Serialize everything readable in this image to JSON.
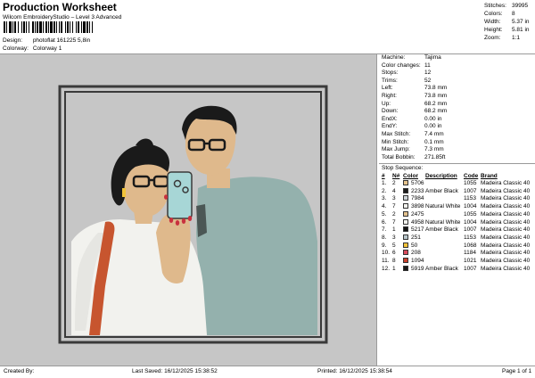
{
  "header": {
    "title": "Production Worksheet",
    "subtitle": "Wilcom EmbroideryStudio – Level 3 Advanced",
    "design_label": "Design:",
    "design_value": "photoflat 161225 5,8in",
    "colorway_label": "Colorway:",
    "colorway_value": "Colorway 1"
  },
  "stats": [
    {
      "label": "Stitches:",
      "value": "39995"
    },
    {
      "label": "Colors:",
      "value": "8"
    },
    {
      "label": "Width:",
      "value": "5.37 in"
    },
    {
      "label": "Height:",
      "value": "5.81 in"
    },
    {
      "label": "Zoom:",
      "value": "1:1"
    }
  ],
  "machine": [
    {
      "label": "Machine:",
      "value": "Tajima"
    },
    {
      "label": "Color changes:",
      "value": "11"
    },
    {
      "label": "Stops:",
      "value": "12"
    },
    {
      "label": "Trims:",
      "value": "52"
    },
    {
      "label": "Left:",
      "value": "73.8 mm"
    },
    {
      "label": "Right:",
      "value": "73.8 mm"
    },
    {
      "label": "Up:",
      "value": "68.2 mm"
    },
    {
      "label": "Down:",
      "value": "68.2 mm"
    },
    {
      "label": "EndX:",
      "value": "0.00 in"
    },
    {
      "label": "EndY:",
      "value": "0.00 in"
    },
    {
      "label": "Max Stitch:",
      "value": "7.4 mm"
    },
    {
      "label": "Min Stitch:",
      "value": "0.1 mm"
    },
    {
      "label": "Max Jump:",
      "value": "7.3 mm"
    },
    {
      "label": "Total Bobbin:",
      "value": "271.85ft"
    }
  ],
  "sequence": {
    "title": "Stop Sequence:",
    "headers": [
      "#",
      "N#",
      "Color",
      "Description",
      "Code",
      "Brand"
    ],
    "rows": [
      {
        "num": "1.",
        "n": "2",
        "color_code": "5706",
        "hex": "#e6c48e",
        "desc": "",
        "code": "1055",
        "brand": "Madeira Classic 40"
      },
      {
        "num": "2.",
        "n": "4",
        "color_code": "2233",
        "hex": "#1c1c1c",
        "desc": "Amber Black",
        "code": "1007",
        "brand": "Madeira Classic 40"
      },
      {
        "num": "3.",
        "n": "3",
        "color_code": "7984",
        "hex": "#cbd2d6",
        "desc": "",
        "code": "1153",
        "brand": "Madeira Classic 40"
      },
      {
        "num": "4.",
        "n": "7",
        "color_code": "3898",
        "hex": "#f3f3ee",
        "desc": "Natural White",
        "code": "1004",
        "brand": "Madeira Classic 40"
      },
      {
        "num": "5.",
        "n": "2",
        "color_code": "2475",
        "hex": "#e2c08c",
        "desc": "",
        "code": "1055",
        "brand": "Madeira Classic 40"
      },
      {
        "num": "6.",
        "n": "7",
        "color_code": "4958",
        "hex": "#f4f4ef",
        "desc": "Natural White",
        "code": "1004",
        "brand": "Madeira Classic 40"
      },
      {
        "num": "7.",
        "n": "1",
        "color_code": "5217",
        "hex": "#141414",
        "desc": "Amber Black",
        "code": "1007",
        "brand": "Madeira Classic 40"
      },
      {
        "num": "8.",
        "n": "3",
        "color_code": "251",
        "hex": "#b9c7cc",
        "desc": "",
        "code": "1153",
        "brand": "Madeira Classic 40"
      },
      {
        "num": "9.",
        "n": "5",
        "color_code": "50",
        "hex": "#f2c33a",
        "desc": "",
        "code": "1068",
        "brand": "Madeira Classic 40"
      },
      {
        "num": "10.",
        "n": "6",
        "color_code": "208",
        "hex": "#d94b5c",
        "desc": "",
        "code": "1184",
        "brand": "Madeira Classic 40"
      },
      {
        "num": "11.",
        "n": "8",
        "color_code": "1094",
        "hex": "#c8402c",
        "desc": "",
        "code": "1021",
        "brand": "Madeira Classic 40"
      },
      {
        "num": "12.",
        "n": "1",
        "color_code": "5919",
        "hex": "#181818",
        "desc": "Amber Black",
        "code": "1007",
        "brand": "Madeira Classic 40"
      }
    ]
  },
  "footer": {
    "created": "Created By:",
    "last_saved": "Last Saved: 16/12/2025 15:38:52",
    "printed": "Printed: 16/12/2025 15:38:54",
    "page": "Page 1 of 1"
  },
  "colors": {
    "canvas_bg": "#c6c6c6",
    "frame": "#3a3a3a",
    "skin": "#dfb98c",
    "shirt_man": "#94b1ad",
    "shirt_woman": "#f2f2ee",
    "bag_strap": "#c7552f",
    "hair": "#1a1a1a",
    "phone": "#a7d6d6",
    "nails": "#c8313e"
  }
}
